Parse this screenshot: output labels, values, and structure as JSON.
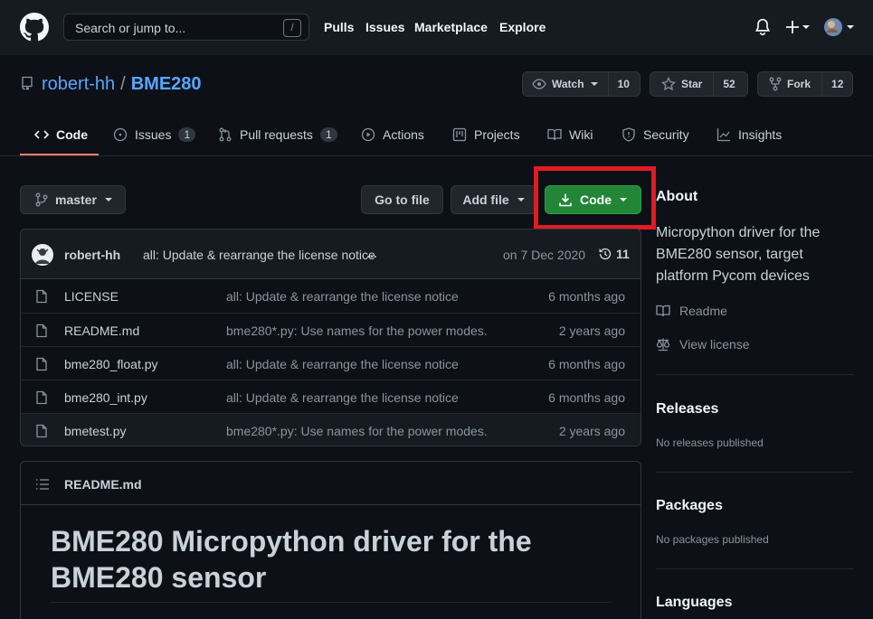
{
  "header": {
    "search_placeholder": "Search or jump to...",
    "search_key": "/",
    "nav": [
      "Pulls",
      "Issues",
      "Marketplace",
      "Explore"
    ]
  },
  "repo": {
    "owner": "robert-hh",
    "separator": "/",
    "name": "BME280",
    "watch_label": "Watch",
    "watch_count": "10",
    "star_label": "Star",
    "star_count": "52",
    "fork_label": "Fork",
    "fork_count": "12"
  },
  "tabs": [
    {
      "label": "Code"
    },
    {
      "label": "Issues",
      "count": "1"
    },
    {
      "label": "Pull requests",
      "count": "1"
    },
    {
      "label": "Actions"
    },
    {
      "label": "Projects"
    },
    {
      "label": "Wiki"
    },
    {
      "label": "Security"
    },
    {
      "label": "Insights"
    }
  ],
  "toolbar": {
    "branch": "master",
    "goto_file": "Go to file",
    "add_file": "Add file",
    "code": "Code"
  },
  "commit": {
    "author": "robert-hh",
    "message": "all: Update & rearrange the license notice",
    "ellipsis": "…",
    "date": "on 7 Dec 2020",
    "count": "11"
  },
  "files": [
    {
      "name": "LICENSE",
      "message": "all: Update & rearrange the license notice",
      "age": "6 months ago"
    },
    {
      "name": "README.md",
      "message": "bme280*.py: Use names for the power modes.",
      "age": "2 years ago"
    },
    {
      "name": "bme280_float.py",
      "message": "all: Update & rearrange the license notice",
      "age": "6 months ago"
    },
    {
      "name": "bme280_int.py",
      "message": "all: Update & rearrange the license notice",
      "age": "6 months ago"
    },
    {
      "name": "bmetest.py",
      "message": "bme280*.py: Use names for the power modes.",
      "age": "2 years ago"
    }
  ],
  "readme": {
    "filename": "README.md",
    "heading": "BME280 Micropython driver for the BME280 sensor"
  },
  "sidebar": {
    "about_title": "About",
    "description": "Micropython driver for the BME280 sensor, target platform Pycom devices",
    "readme_link": "Readme",
    "license_link": "View license",
    "releases_title": "Releases",
    "releases_text": "No releases published",
    "packages_title": "Packages",
    "packages_text": "No packages published",
    "languages_title": "Languages"
  },
  "colors": {
    "code_button": "#238636",
    "highlight": "#e21b22",
    "link": "#58a6ff",
    "tab_underline": "#f78166"
  }
}
